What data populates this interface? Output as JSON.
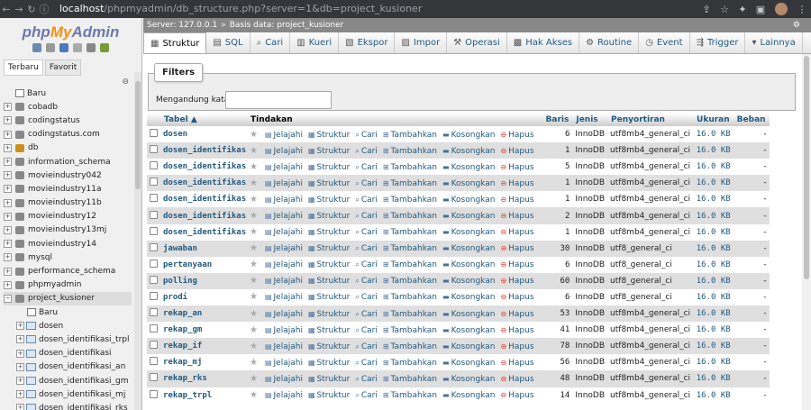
{
  "browser": {
    "url_host": "localhost",
    "url_path": "/phpmyadmin/db_structure.php?server=1&db=project_kusioner"
  },
  "logo": {
    "php": "php",
    "my": "My",
    "admin": "Admin"
  },
  "nav_tabs": {
    "recent": "Terbaru",
    "favorites": "Favorit"
  },
  "tree": [
    {
      "label": "Baru",
      "type": "new",
      "indent": 1
    },
    {
      "label": "cobadb",
      "type": "db"
    },
    {
      "label": "codingstatus",
      "type": "db"
    },
    {
      "label": "codingstatus.com",
      "type": "db"
    },
    {
      "label": "db",
      "type": "db",
      "hi": true
    },
    {
      "label": "information_schema",
      "type": "db"
    },
    {
      "label": "movieindustry042",
      "type": "db"
    },
    {
      "label": "movieindustry11a",
      "type": "db"
    },
    {
      "label": "movieindustry11b",
      "type": "db"
    },
    {
      "label": "movieindustry12",
      "type": "db"
    },
    {
      "label": "movieindustry13mj",
      "type": "db"
    },
    {
      "label": "movieindustry14",
      "type": "db"
    },
    {
      "label": "mysql",
      "type": "db"
    },
    {
      "label": "performance_schema",
      "type": "db"
    },
    {
      "label": "phpmyadmin",
      "type": "db"
    },
    {
      "label": "project_kusioner",
      "type": "db",
      "open": true
    },
    {
      "label": "Baru",
      "type": "new",
      "indent": 2
    },
    {
      "label": "dosen",
      "type": "tbl"
    },
    {
      "label": "dosen_identifikasi_trpl",
      "type": "tbl"
    },
    {
      "label": "dosen_identifikasi",
      "type": "tbl"
    },
    {
      "label": "dosen_identifikasi_an",
      "type": "tbl"
    },
    {
      "label": "dosen_identifikasi_gm",
      "type": "tbl"
    },
    {
      "label": "dosen_identifikasi_mj",
      "type": "tbl"
    },
    {
      "label": "dosen_identifikasi_rks",
      "type": "tbl"
    }
  ],
  "breadcrumb": {
    "server": "Server: 127.0.0.1",
    "database": "Basis data: project_kusioner"
  },
  "menu": [
    {
      "label": "Struktur",
      "icon": "structure-icon",
      "active": true
    },
    {
      "label": "SQL",
      "icon": "sql-icon"
    },
    {
      "label": "Cari",
      "icon": "search-icon"
    },
    {
      "label": "Kueri",
      "icon": "query-icon"
    },
    {
      "label": "Ekspor",
      "icon": "export-icon"
    },
    {
      "label": "Impor",
      "icon": "import-icon"
    },
    {
      "label": "Operasi",
      "icon": "wrench-icon"
    },
    {
      "label": "Hak Akses",
      "icon": "privileges-icon"
    },
    {
      "label": "Routine",
      "icon": "routine-icon"
    },
    {
      "label": "Event",
      "icon": "clock-icon"
    },
    {
      "label": "Trigger",
      "icon": "trigger-icon"
    },
    {
      "label": "Lainnya",
      "icon": "chevron-down-icon"
    }
  ],
  "filters": {
    "legend": "Filters",
    "label": "Mengandung kata:",
    "value": ""
  },
  "table": {
    "headers": {
      "table": "Tabel",
      "actions": "Tindakan",
      "rows": "Baris",
      "engine": "Jenis",
      "collation": "Penyortiran",
      "size": "Ukuran",
      "overhead": "Beban"
    },
    "actions": {
      "browse": "Jelajahi",
      "structure": "Struktur",
      "search": "Cari",
      "insert": "Tambahkan",
      "empty": "Kosongkan",
      "drop": "Hapus"
    },
    "rows": [
      {
        "name": "dosen",
        "rows": "6",
        "engine": "InnoDB",
        "collation": "utf8mb4_general_ci",
        "size": "16.0 KB",
        "overhead": "-"
      },
      {
        "name": "dosen_identifikasi_trpl",
        "rows": "1",
        "engine": "InnoDB",
        "collation": "utf8mb4_general_ci",
        "size": "16.0 KB",
        "overhead": "-"
      },
      {
        "name": "dosen_identifikasi",
        "rows": "5",
        "engine": "InnoDB",
        "collation": "utf8mb4_general_ci",
        "size": "16.0 KB",
        "overhead": "-"
      },
      {
        "name": "dosen_identifikasi_an",
        "rows": "1",
        "engine": "InnoDB",
        "collation": "utf8mb4_general_ci",
        "size": "16.0 KB",
        "overhead": "-"
      },
      {
        "name": "dosen_identifikasi_gm",
        "rows": "1",
        "engine": "InnoDB",
        "collation": "utf8mb4_general_ci",
        "size": "16.0 KB",
        "overhead": "-"
      },
      {
        "name": "dosen_identifikasi_mj",
        "rows": "2",
        "engine": "InnoDB",
        "collation": "utf8mb4_general_ci",
        "size": "16.0 KB",
        "overhead": "-"
      },
      {
        "name": "dosen_identifikasi_rks",
        "rows": "1",
        "engine": "InnoDB",
        "collation": "utf8mb4_general_ci",
        "size": "16.0 KB",
        "overhead": "-"
      },
      {
        "name": "jawaban",
        "rows": "30",
        "engine": "InnoDB",
        "collation": "utf8_general_ci",
        "size": "16.0 KB",
        "overhead": "-"
      },
      {
        "name": "pertanyaan",
        "rows": "6",
        "engine": "InnoDB",
        "collation": "utf8_general_ci",
        "size": "16.0 KB",
        "overhead": "-"
      },
      {
        "name": "polling",
        "rows": "60",
        "engine": "InnoDB",
        "collation": "utf8_general_ci",
        "size": "16.0 KB",
        "overhead": "-"
      },
      {
        "name": "prodi",
        "rows": "6",
        "engine": "InnoDB",
        "collation": "utf8_general_ci",
        "size": "16.0 KB",
        "overhead": "-"
      },
      {
        "name": "rekap_an",
        "rows": "53",
        "engine": "InnoDB",
        "collation": "utf8mb4_general_ci",
        "size": "16.0 KB",
        "overhead": "-"
      },
      {
        "name": "rekap_gm",
        "rows": "41",
        "engine": "InnoDB",
        "collation": "utf8mb4_general_ci",
        "size": "16.0 KB",
        "overhead": "-"
      },
      {
        "name": "rekap_if",
        "rows": "78",
        "engine": "InnoDB",
        "collation": "utf8mb4_general_ci",
        "size": "16.0 KB",
        "overhead": "-"
      },
      {
        "name": "rekap_mj",
        "rows": "56",
        "engine": "InnoDB",
        "collation": "utf8mb4_general_ci",
        "size": "16.0 KB",
        "overhead": "-"
      },
      {
        "name": "rekap_rks",
        "rows": "48",
        "engine": "InnoDB",
        "collation": "utf8mb4_general_ci",
        "size": "16.0 KB",
        "overhead": "-"
      },
      {
        "name": "rekap_trpl",
        "rows": "14",
        "engine": "InnoDB",
        "collation": "utf8mb4_general_ci",
        "size": "16.0 KB",
        "overhead": "-"
      }
    ]
  }
}
